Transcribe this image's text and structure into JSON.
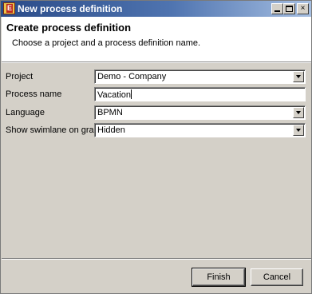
{
  "window": {
    "title": "New process definition",
    "app_icon_letter": "E",
    "min_icon": "minimize-icon",
    "max_icon": "maximize-icon",
    "close_label": "×"
  },
  "header": {
    "title": "Create process definition",
    "description": "Choose a project and a process definition name."
  },
  "form": {
    "project_label": "Project",
    "project_value": "Demo - Company",
    "process_name_label": "Process name",
    "process_name_value": "Vacation",
    "language_label": "Language",
    "language_value": "BPMN",
    "swimlane_label": "Show swimlane on graph",
    "swimlane_value": "Hidden"
  },
  "buttons": {
    "finish": "Finish",
    "cancel": "Cancel"
  }
}
